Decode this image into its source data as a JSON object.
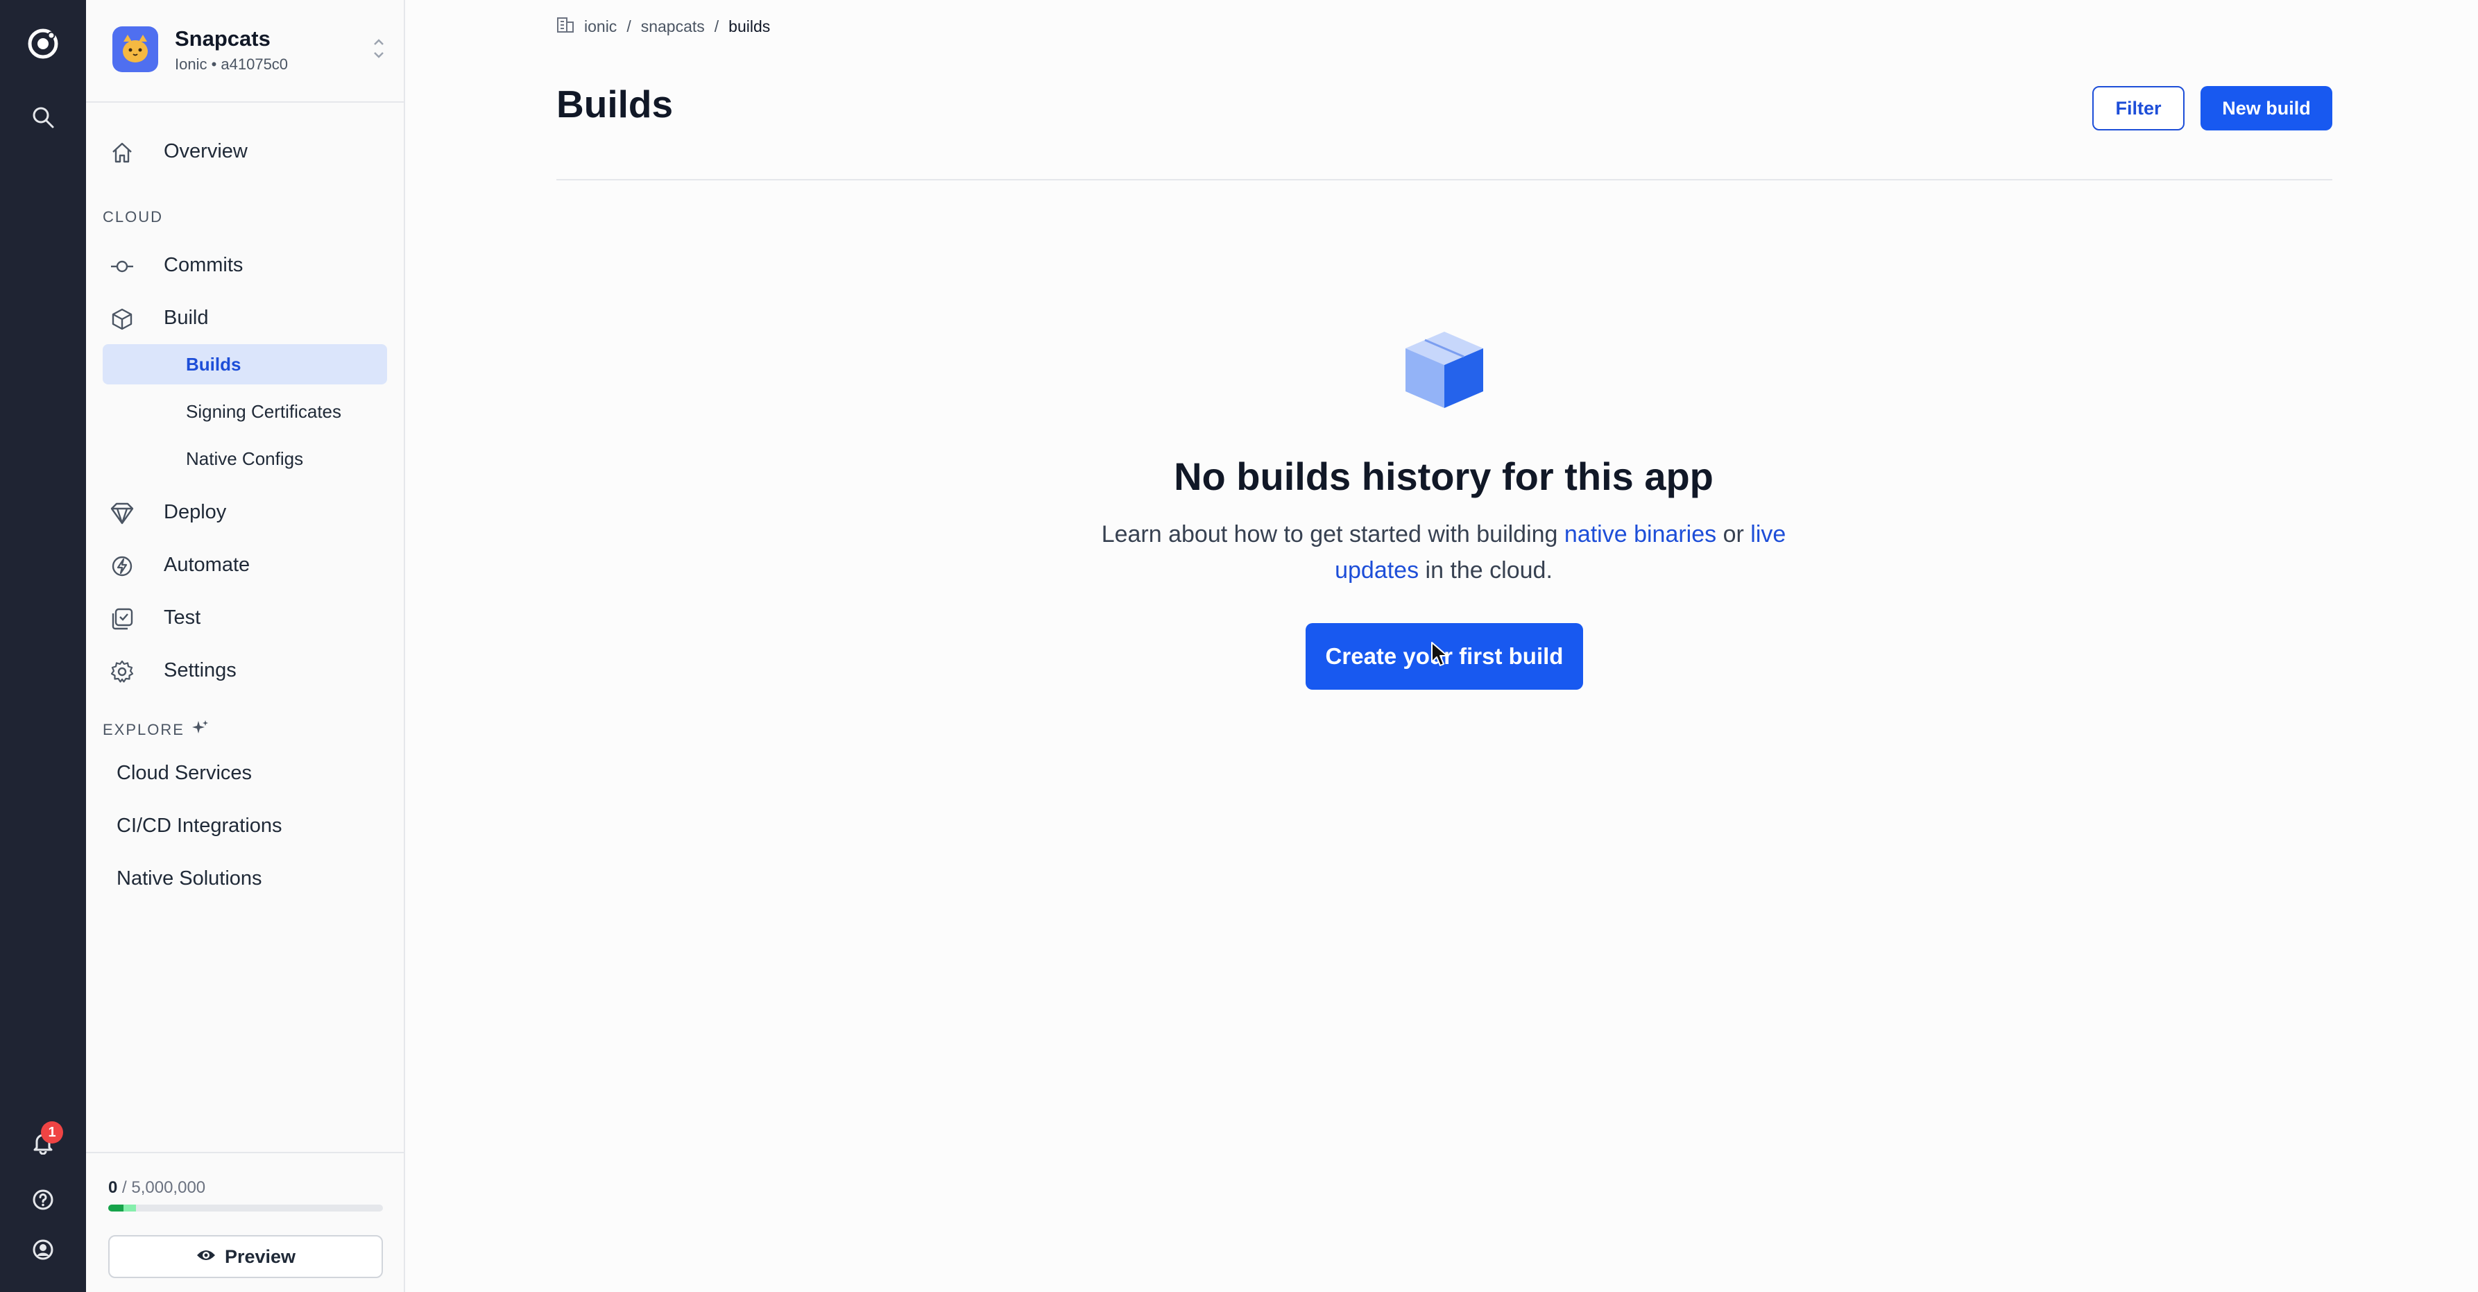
{
  "app": {
    "name": "Snapcats",
    "subtitle": "Ionic • a41075c0"
  },
  "sidebar": {
    "overview": "Overview",
    "cloud_section": "CLOUD",
    "commits": "Commits",
    "build": "Build",
    "build_sub": [
      "Builds",
      "Signing Certificates",
      "Native Configs"
    ],
    "deploy": "Deploy",
    "automate": "Automate",
    "test": "Test",
    "settings": "Settings",
    "explore_section": "EXPLORE",
    "explore_items": [
      "Cloud Services",
      "CI/CD Integrations",
      "Native Solutions"
    ]
  },
  "usage": {
    "used": "0",
    "limit": "/ 5,000,000",
    "fill_fraction": 0.1
  },
  "preview_button": "Preview",
  "notifications": {
    "count": "1"
  },
  "breadcrumb": [
    "ionic",
    "/",
    "snapcats",
    "/",
    "builds"
  ],
  "page": {
    "title": "Builds",
    "filter_button": "Filter",
    "new_build_button": "New build"
  },
  "empty_state": {
    "title": "No builds history for this app",
    "desc_prefix": "Learn about how to get started with building ",
    "link_native": "native binaries",
    "desc_or": " or ",
    "link_live": "live updates",
    "desc_suffix": " in the cloud.",
    "cta": "Create your first build"
  },
  "colors": {
    "rail_bg": "#1f2433",
    "primary": "#1859f0",
    "link": "#1d4ed8",
    "active_bg": "#dbe5fb"
  }
}
